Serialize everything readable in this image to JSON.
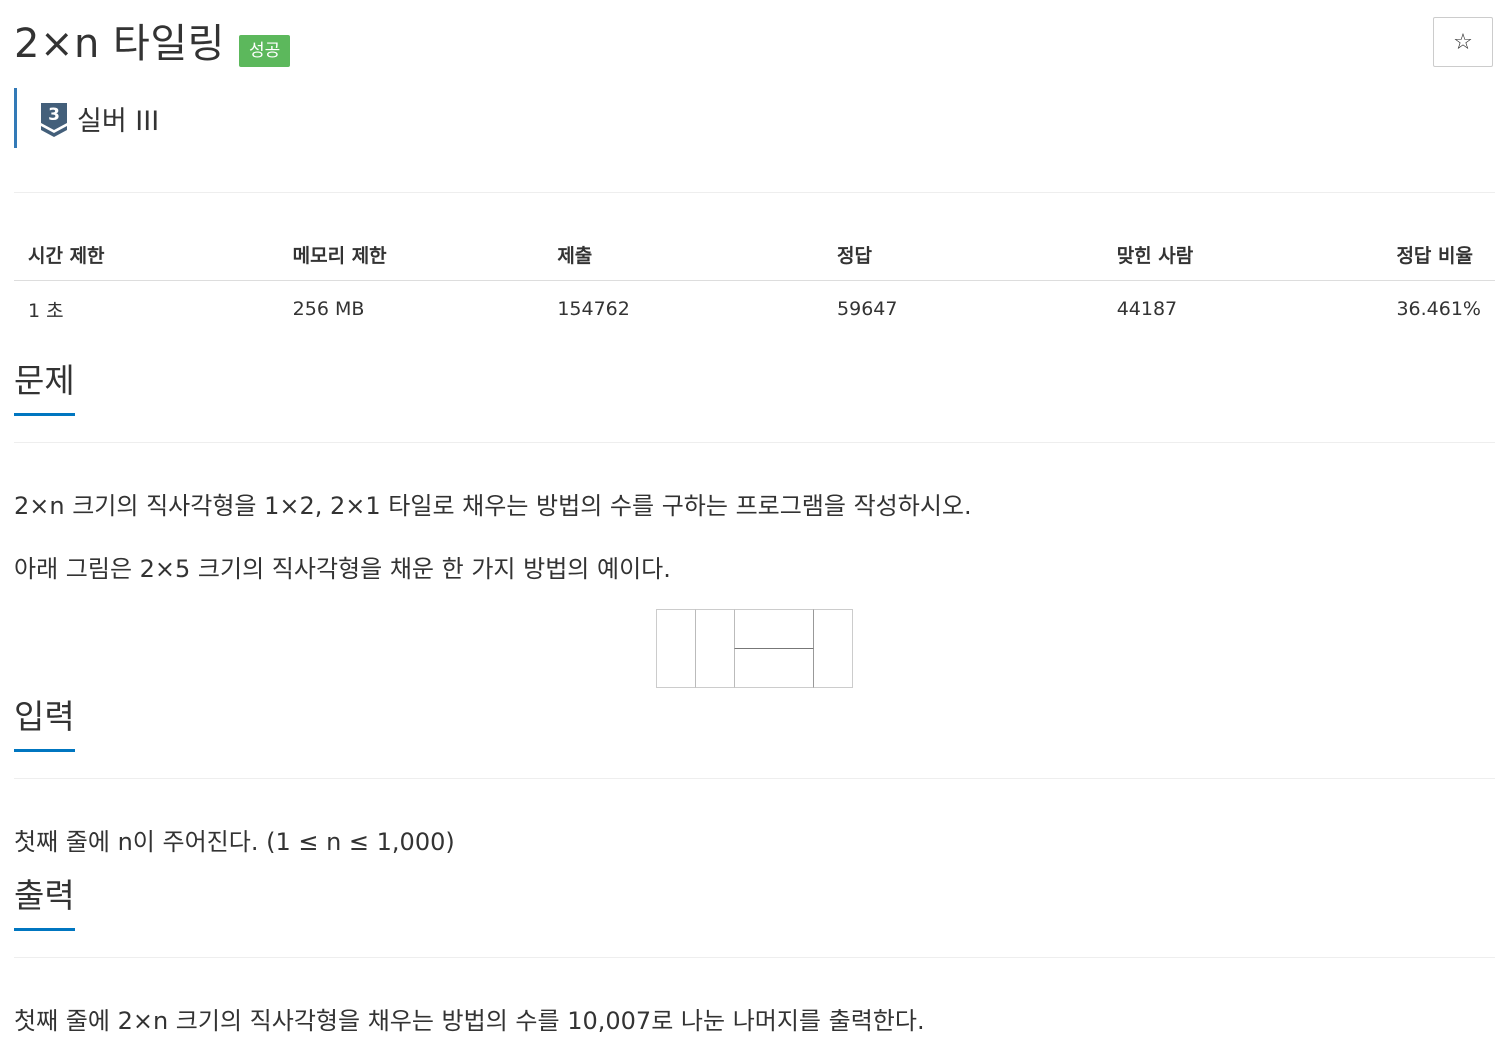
{
  "problem": {
    "title": "2×n 타일링",
    "status_badge": "성공",
    "star_glyph": "☆",
    "tier": {
      "number": "3",
      "label": "실버 III",
      "color": "#435f7a"
    }
  },
  "info_table": {
    "headers": [
      "시간 제한",
      "메모리 제한",
      "제출",
      "정답",
      "맞힌 사람",
      "정답 비율"
    ],
    "values": [
      "1 초",
      "256 MB",
      "154762",
      "59647",
      "44187",
      "36.461%"
    ]
  },
  "sections": {
    "problem": {
      "title": "문제",
      "paragraphs": [
        "2×n 크기의 직사각형을 1×2, 2×1 타일로 채우는 방법의 수를 구하는 프로그램을 작성하시오.",
        "아래 그림은 2×5 크기의 직사각형을 채운 한 가지 방법의 예이다."
      ]
    },
    "input": {
      "title": "입력",
      "text": "첫째 줄에 n이 주어진다. (1 ≤ n ≤ 1,000)"
    },
    "output": {
      "title": "출력",
      "text": "첫째 줄에 2×n 크기의 직사각형을 채우는 방법의 수를 10,007로 나눈 나머지를 출력한다."
    }
  },
  "colors": {
    "accent": "#0076c0",
    "success": "#5cb85c",
    "tier_border": "#337ab7"
  }
}
